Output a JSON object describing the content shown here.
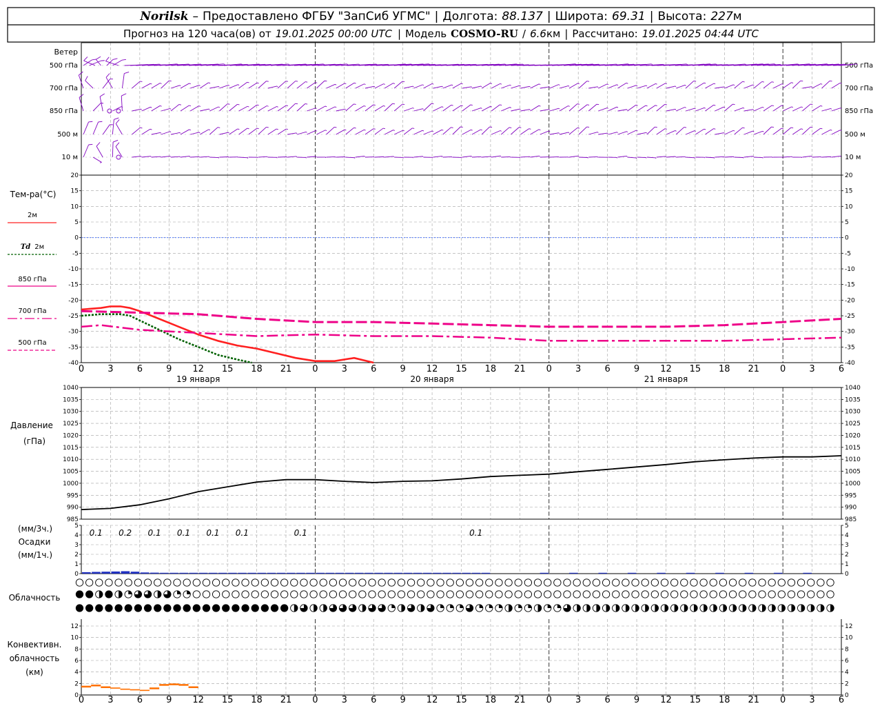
{
  "header": {
    "station": "Norilsk",
    "station_sep": "–",
    "provider": "Предоставлено ФГБУ \"ЗапСиб УГМС\"",
    "lon_label": "Долгота:",
    "lon_value": "88.137",
    "lat_label": "Широта:",
    "lat_value": "69.31",
    "alt_label": "Высота:",
    "alt_value": "227",
    "alt_unit": "м",
    "forecast_label": "Прогноз на 120 часа(ов) от",
    "forecast_start": "19.01.2025 00:00 UTC",
    "model_label": "Модель",
    "model_name": "COSMO-RU",
    "model_res_sep": "/",
    "model_res": "6.6",
    "model_res_unit": "км",
    "calc_label": "Рассчитано:",
    "calc_time": "19.01.2025 04:44 UTC"
  },
  "colors": {
    "wind": "#8000c0",
    "t2m": "#ff2020",
    "td2m": "#006000",
    "upper": "#ee0088",
    "zero": "#3060ff",
    "pressure": "#000000",
    "precip": "#2030c0",
    "convective": "#ff7000",
    "grid": "#a0a0a0"
  },
  "time_axis": {
    "tick_labels": [
      "0",
      "3",
      "6",
      "9",
      "12",
      "15",
      "18",
      "21",
      "0",
      "3",
      "6",
      "9",
      "12",
      "15",
      "18",
      "21",
      "0",
      "3",
      "6",
      "9",
      "12",
      "15",
      "18",
      "21",
      "0",
      "3",
      "6"
    ],
    "day_labels": [
      "19 января",
      "20 января",
      "21 января"
    ]
  },
  "wind_panel": {
    "title": "Ветер",
    "levels": [
      "500 гПа",
      "700 гПа",
      "850 гПа",
      "500 м",
      "10 м"
    ]
  },
  "temp_panel": {
    "title": "Тем-ра(°С)",
    "legend": [
      {
        "label": "2м",
        "style": "solid"
      },
      {
        "label_italic": "Td",
        "label": "2м",
        "style": "dotted"
      },
      {
        "label": "850 гПа",
        "style": "solid-thin"
      },
      {
        "label": "700 гПа",
        "style": "dashdot"
      },
      {
        "label": "500 гПа",
        "style": "dashed"
      }
    ],
    "y_ticks": [
      "20",
      "15",
      "10",
      "5",
      "0",
      "-5",
      "-10",
      "-15",
      "-20",
      "-25",
      "-30",
      "-35",
      "-40"
    ]
  },
  "pressure_panel": {
    "title": "Давление",
    "unit": "(гПа)",
    "y_ticks": [
      "1040",
      "1035",
      "1030",
      "1025",
      "1020",
      "1015",
      "1010",
      "1005",
      "1000",
      "995",
      "990",
      "985"
    ]
  },
  "precip_panel": {
    "title_top": "(мм/3ч.)",
    "title": "Осадки",
    "title_bottom": "(мм/1ч.)",
    "y_ticks": [
      "5",
      "4",
      "3",
      "2",
      "1",
      "0"
    ],
    "labels": [
      {
        "hour": 1.5,
        "text": "0.1"
      },
      {
        "hour": 4.5,
        "text": "0.2"
      },
      {
        "hour": 7.5,
        "text": "0.1"
      },
      {
        "hour": 10.5,
        "text": "0.1"
      },
      {
        "hour": 13.5,
        "text": "0.1"
      },
      {
        "hour": 16.5,
        "text": "0.1"
      },
      {
        "hour": 22.5,
        "text": "0.1"
      },
      {
        "hour": 40.5,
        "text": "0.1"
      }
    ]
  },
  "cloud_panel": {
    "title": "Облачность"
  },
  "conv_panel": {
    "title_1": "Конвективн.",
    "title_2": "облачность",
    "title_3": "(км)",
    "y_ticks": [
      "12",
      "10",
      "8",
      "6",
      "4",
      "2",
      "0"
    ]
  },
  "chart_data": [
    {
      "type": "line",
      "title": "Тем-ра(°С)",
      "x_unit": "hours from 19.01.2025 00:00 UTC",
      "ylim": [
        -40,
        20
      ],
      "series": [
        {
          "name": "2м",
          "x": [
            0,
            2,
            3,
            4,
            5,
            6,
            8,
            10,
            12,
            14,
            16,
            18,
            20,
            22,
            24,
            26,
            28,
            30
          ],
          "values": [
            -23,
            -22.5,
            -22,
            -22,
            -22.5,
            -23.5,
            -26,
            -28.5,
            -31,
            -33,
            -34.5,
            -35.5,
            -37,
            -38.5,
            -39.5,
            -39.5,
            -38.5,
            -40
          ]
        },
        {
          "name": "Td 2м",
          "x": [
            0,
            2,
            4,
            5,
            6,
            8,
            10,
            12,
            14,
            16,
            17.5
          ],
          "values": [
            -25,
            -24.5,
            -24.5,
            -25,
            -26.5,
            -29.5,
            -32.5,
            -35,
            -37.5,
            -39,
            -40
          ]
        },
        {
          "name": "700 гПа",
          "x": [
            0,
            6,
            12,
            18,
            24,
            30,
            36,
            42,
            48,
            54,
            60,
            66,
            72,
            78
          ],
          "values": [
            -23.5,
            -24,
            -24.5,
            -26,
            -27,
            -27,
            -27.5,
            -28,
            -28.5,
            -28.5,
            -28.5,
            -28,
            -27,
            -26
          ]
        },
        {
          "name": "500 гПа",
          "x": [
            0,
            2,
            6,
            12,
            18,
            24,
            30,
            36,
            42,
            48,
            54,
            60,
            66,
            72,
            78
          ],
          "values": [
            -28.5,
            -28,
            -29.5,
            -30.5,
            -31.5,
            -31,
            -31.5,
            -31.5,
            -32,
            -33,
            -33,
            -33,
            -33,
            -32.5,
            -32
          ]
        }
      ]
    },
    {
      "type": "line",
      "title": "Давление",
      "ylabel": "(гПа)",
      "x_unit": "hours from 19.01.2025 00:00 UTC",
      "ylim": [
        985,
        1040
      ],
      "series": [
        {
          "name": "Давление",
          "x": [
            0,
            3,
            6,
            9,
            12,
            15,
            18,
            21,
            24,
            27,
            30,
            33,
            36,
            39,
            42,
            45,
            48,
            51,
            54,
            57,
            60,
            63,
            66,
            69,
            72,
            75,
            78
          ],
          "values": [
            989,
            989.5,
            991,
            993.5,
            996.5,
            998.5,
            1000.5,
            1001.5,
            1001.5,
            1000.8,
            1000.3,
            1000.8,
            1001,
            1001.8,
            1002.8,
            1003.3,
            1003.8,
            1004.8,
            1005.8,
            1006.8,
            1007.8,
            1009,
            1009.8,
            1010.5,
            1011,
            1011,
            1011.5
          ]
        }
      ]
    },
    {
      "type": "bar",
      "title": "Осадки",
      "x_unit": "hours from 19.01.2025 00:00 UTC",
      "ylim": [
        0,
        5
      ],
      "series": [
        {
          "name": "мм/1ч.",
          "x": [
            1,
            2,
            3,
            4,
            5,
            6,
            7,
            8,
            9,
            10,
            11,
            12,
            13,
            14,
            15,
            16,
            17,
            18,
            19,
            20,
            21,
            22,
            23,
            24,
            25,
            26,
            27,
            28,
            29,
            30,
            31,
            32,
            33,
            34,
            35,
            36,
            37,
            38,
            39,
            40,
            41,
            42,
            48,
            51,
            54,
            57,
            60,
            63,
            66,
            69,
            72,
            75
          ],
          "values": [
            0.15,
            0.18,
            0.2,
            0.22,
            0.25,
            0.2,
            0.12,
            0.1,
            0.08,
            0.08,
            0.07,
            0.07,
            0.06,
            0.05,
            0.05,
            0.06,
            0.05,
            0.04,
            0.04,
            0.05,
            0.04,
            0.04,
            0.03,
            0.05,
            0.04,
            0.03,
            0.03,
            0.04,
            0.03,
            0.04,
            0.03,
            0.03,
            0.03,
            0.03,
            0.02,
            0.03,
            0.02,
            0.02,
            0.02,
            0.03,
            0.04,
            0.03,
            0.03,
            0.04,
            0.03,
            0.04,
            0.03,
            0.03,
            0.03,
            0.02,
            0.03,
            0.03
          ]
        }
      ]
    },
    {
      "type": "bar",
      "title": "Конвективн. облачность (км)",
      "x_unit": "hours from 19.01.2025 00:00 UTC",
      "ylim": [
        0,
        12
      ],
      "series": [
        {
          "name": "bottom",
          "x": [
            0.5,
            1.5,
            2.5,
            3.5,
            4.5,
            5.5,
            6.5,
            7.5,
            8.5,
            9.5,
            10.5,
            11.5
          ],
          "values": [
            1.3,
            1.5,
            1.2,
            1.1,
            0.9,
            0.8,
            0.7,
            1.0,
            1.6,
            1.7,
            1.6,
            1.2
          ]
        },
        {
          "name": "top",
          "x": [
            0.5,
            1.5,
            2.5,
            3.5,
            4.5,
            5.5,
            6.5,
            7.5,
            8.5,
            9.5,
            10.5,
            11.5
          ],
          "values": [
            1.6,
            1.8,
            1.5,
            1.3,
            1.1,
            1.0,
            0.9,
            1.3,
            1.9,
            2.0,
            1.9,
            1.5
          ]
        }
      ]
    },
    {
      "type": "table",
      "title": "Облачность",
      "x_unit": "hours from 19.01.2025 00:00 UTC",
      "note": "fraction of circle filled per hour, rows: upper, middle, lower",
      "rows": {
        "upper": [
          0,
          0,
          0,
          0,
          0,
          0,
          0,
          0,
          0,
          0,
          0,
          0,
          0,
          0,
          0,
          0,
          0,
          0,
          0,
          0,
          0,
          0,
          0,
          0,
          0,
          0,
          0,
          0,
          0,
          0,
          0,
          0,
          0,
          0,
          0,
          0,
          0,
          0,
          0,
          0,
          0,
          0,
          0,
          0,
          0,
          0,
          0,
          0,
          0,
          0,
          0,
          0,
          0,
          0,
          0,
          0,
          0,
          0,
          0,
          0,
          0,
          0,
          0,
          0,
          0,
          0,
          0,
          0,
          0,
          0,
          0,
          0,
          0,
          0,
          0,
          0,
          0,
          0
        ],
        "middle": [
          1,
          1,
          0.5,
          1,
          0.5,
          0.25,
          0.75,
          0.75,
          0.5,
          0.75,
          0.25,
          0.25,
          0,
          0,
          0,
          0,
          0,
          0,
          0,
          0,
          0,
          0,
          0,
          0,
          0,
          0,
          0,
          0,
          0,
          0,
          0,
          0,
          0,
          0,
          0,
          0,
          0,
          0,
          0,
          0,
          0,
          0,
          0,
          0,
          0,
          0,
          0,
          0,
          0,
          0,
          0,
          0,
          0,
          0,
          0,
          0,
          0,
          0,
          0,
          0,
          0,
          0,
          0,
          0,
          0,
          0,
          0,
          0,
          0,
          0,
          0,
          0,
          0,
          0,
          0,
          0,
          0,
          0
        ],
        "lower": [
          1,
          1,
          1,
          1,
          1,
          1,
          1,
          1,
          1,
          1,
          1,
          1,
          1,
          1,
          1,
          1,
          1,
          1,
          1,
          1,
          1,
          1,
          0.5,
          0.75,
          0.5,
          0.5,
          0.75,
          0.75,
          0.75,
          0.5,
          0.75,
          0.75,
          0.25,
          0.5,
          0.75,
          0.5,
          0.75,
          0.25,
          0.25,
          0.25,
          0.75,
          0.25,
          0.25,
          0.25,
          0.5,
          0.25,
          0.25,
          0.5,
          0.25,
          0.25,
          0.75,
          0.5,
          0.5,
          0.5,
          0.5,
          0.5,
          0.5,
          0.5,
          0.5,
          0.5,
          0.5,
          0.5,
          0.5,
          0.5,
          0.5,
          0.5,
          0.5,
          0.5,
          0.5,
          0.5,
          0.5,
          0.5,
          0.5,
          0.5,
          0.5,
          0.5,
          0.5,
          0.5
        ]
      }
    }
  ]
}
